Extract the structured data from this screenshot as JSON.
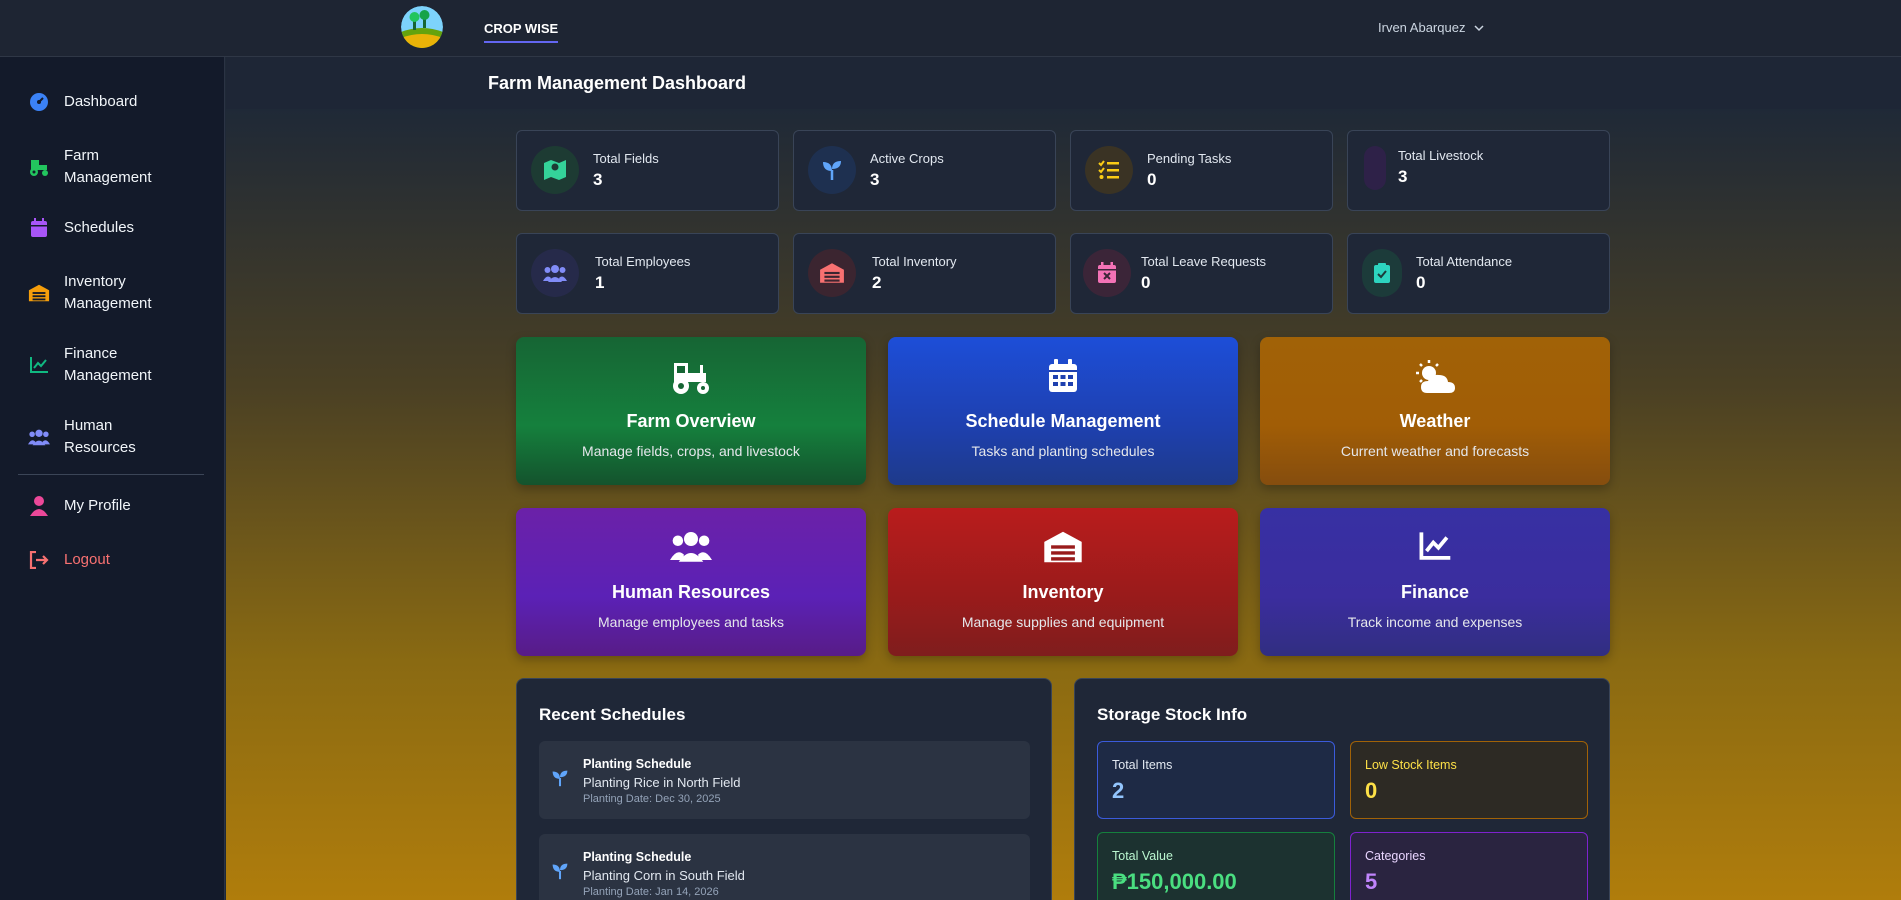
{
  "app": {
    "brand": "CROP WISE",
    "user": "Irven Abarquez"
  },
  "sidebar": {
    "items": [
      {
        "label": "Dashboard"
      },
      {
        "label": "Farm\nManagement"
      },
      {
        "label": "Schedules"
      },
      {
        "label": "Inventory\nManagement"
      },
      {
        "label": "Finance\nManagement"
      },
      {
        "label": "Human\nResources"
      },
      {
        "label": "My Profile"
      },
      {
        "label": "Logout"
      }
    ]
  },
  "header": {
    "title": "Farm Management Dashboard"
  },
  "stats": [
    {
      "label": "Total Fields",
      "value": "3"
    },
    {
      "label": "Active Crops",
      "value": "3"
    },
    {
      "label": "Pending Tasks",
      "value": "0"
    },
    {
      "label": "Total Livestock",
      "value": "3"
    },
    {
      "label": "Total Employees",
      "value": "1"
    },
    {
      "label": "Total Inventory",
      "value": "2"
    },
    {
      "label": "Total Leave Requests",
      "value": "0"
    },
    {
      "label": "Total Attendance",
      "value": "0"
    }
  ],
  "tiles": [
    {
      "title": "Farm Overview",
      "desc": "Manage fields, crops, and livestock",
      "color": "#15803d"
    },
    {
      "title": "Schedule Management",
      "desc": "Tasks and planting schedules",
      "color": "#1e40af"
    },
    {
      "title": "Weather",
      "desc": "Current weather and forecasts",
      "color": "#a16207"
    },
    {
      "title": "Human Resources",
      "desc": "Manage employees and tasks",
      "color": "#6b21a8"
    },
    {
      "title": "Inventory",
      "desc": "Manage supplies and equipment",
      "color": "#991b1b"
    },
    {
      "title": "Finance",
      "desc": "Track income and expenses",
      "color": "#3730a3"
    }
  ],
  "recent_schedules": {
    "title": "Recent Schedules",
    "items": [
      {
        "type": "Planting Schedule",
        "name": "Planting Rice in North Field",
        "date": "Planting Date: Dec 30, 2025"
      },
      {
        "type": "Planting Schedule",
        "name": "Planting Corn in South Field",
        "date": "Planting Date: Jan 14, 2026"
      }
    ]
  },
  "storage": {
    "title": "Storage Stock Info",
    "boxes": [
      {
        "label": "Total Items",
        "value": "2"
      },
      {
        "label": "Low Stock Items",
        "value": "0"
      },
      {
        "label": "Total Value",
        "value": "₱150,000.00"
      },
      {
        "label": "Categories",
        "value": "5"
      }
    ]
  }
}
